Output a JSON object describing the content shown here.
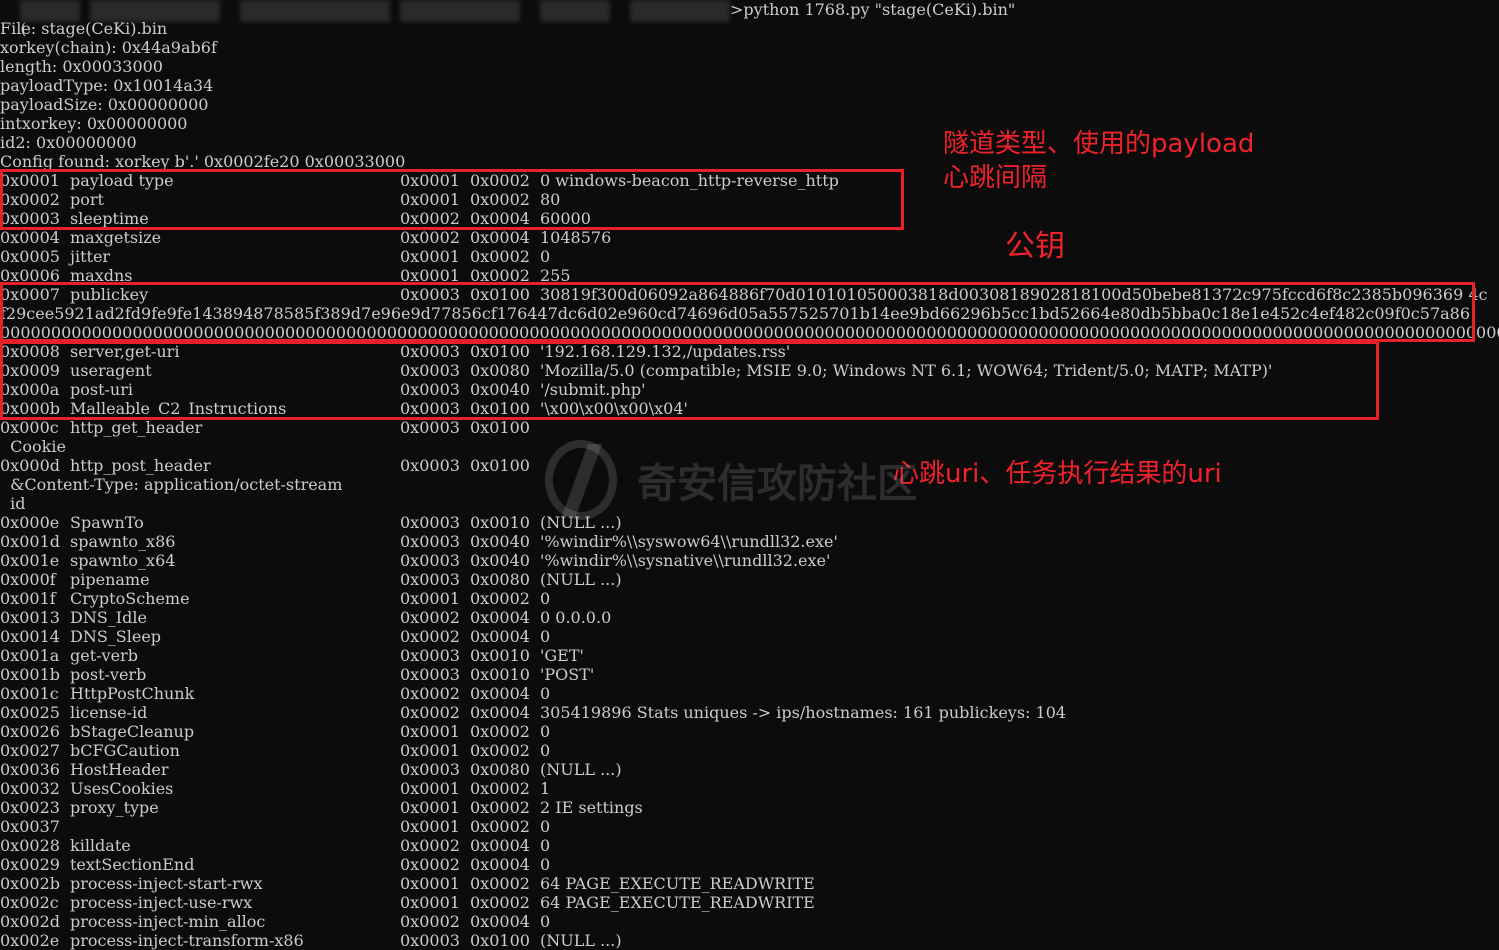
{
  "prompt": {
    "prefix": "(",
    "command": ">python 1768.py \"stage(CeKi).bin\""
  },
  "header_lines": [
    "File: stage(CeKi).bin",
    "xorkey(chain): 0x44a9ab6f",
    "length: 0x00033000",
    "payloadType: 0x10014a34",
    "payloadSize: 0x00000000",
    "intxorkey: 0x00000000",
    "id2: 0x00000000",
    "Config found: xorkey b'.' 0x0002fe20 0x00033000"
  ],
  "entries": [
    {
      "id": "0x0001",
      "name": "payload type",
      "type": "0x0001",
      "len": "0x0002",
      "value": "0 windows-beacon_http-reverse_http"
    },
    {
      "id": "0x0002",
      "name": "port",
      "type": "0x0001",
      "len": "0x0002",
      "value": "80"
    },
    {
      "id": "0x0003",
      "name": "sleeptime",
      "type": "0x0002",
      "len": "0x0004",
      "value": "60000"
    },
    {
      "id": "0x0004",
      "name": "maxgetsize",
      "type": "0x0002",
      "len": "0x0004",
      "value": "1048576"
    },
    {
      "id": "0x0005",
      "name": "jitter",
      "type": "0x0001",
      "len": "0x0002",
      "value": "0"
    },
    {
      "id": "0x0006",
      "name": "maxdns",
      "type": "0x0001",
      "len": "0x0002",
      "value": "255"
    },
    {
      "id": "0x0007",
      "name": "publickey",
      "type": "0x0003",
      "len": "0x0100",
      "value": "30819f300d06092a864886f70d010101050003818d0030818902818100d50bebe81372c975fccd6f8c2385b096369 4c"
    }
  ],
  "publickey_cont": [
    "f29cee5921ad2fd9fe9fe143894878585f389d7e96e9d77856cf176447dc6d02e960cd74696d05a557525701b14ee9bd66296b5cc1bd52664e80db5bba0c18e1e452c4ef482c09f0c57a86",
    "000000000000000000000000000000000000000000000000000000000000000000000000000000000000000000000000000000000000000000000000000000000000000000000000000000"
  ],
  "entries2": [
    {
      "id": "0x0008",
      "name": "server,get-uri",
      "type": "0x0003",
      "len": "0x0100",
      "value": "'192.168.129.132,/updates.rss'"
    },
    {
      "id": "0x0009",
      "name": "useragent",
      "type": "0x0003",
      "len": "0x0080",
      "value": "'Mozilla/5.0 (compatible; MSIE 9.0; Windows NT 6.1; WOW64; Trident/5.0; MATP; MATP)'"
    },
    {
      "id": "0x000a",
      "name": "post-uri",
      "type": "0x0003",
      "len": "0x0040",
      "value": "'/submit.php'"
    },
    {
      "id": "0x000b",
      "name": "Malleable_C2_Instructions",
      "type": "0x0003",
      "len": "0x0100",
      "value": "'\\x00\\x00\\x00\\x04'"
    },
    {
      "id": "0x000c",
      "name": "http_get_header",
      "type": "0x0003",
      "len": "0x0100",
      "value": ""
    }
  ],
  "sub_cookie": "  Cookie",
  "entry_post_header": {
    "id": "0x000d",
    "name": "http_post_header",
    "type": "0x0003",
    "len": "0x0100",
    "value": ""
  },
  "sub_content_type": "  &Content-Type: application/octet-stream",
  "sub_id": "  id",
  "entries3": [
    {
      "id": "0x000e",
      "name": "SpawnTo",
      "type": "0x0003",
      "len": "0x0010",
      "value": "(NULL ...)"
    },
    {
      "id": "0x001d",
      "name": "spawnto_x86",
      "type": "0x0003",
      "len": "0x0040",
      "value": "'%windir%\\\\syswow64\\\\rundll32.exe'"
    },
    {
      "id": "0x001e",
      "name": "spawnto_x64",
      "type": "0x0003",
      "len": "0x0040",
      "value": "'%windir%\\\\sysnative\\\\rundll32.exe'"
    },
    {
      "id": "0x000f",
      "name": "pipename",
      "type": "0x0003",
      "len": "0x0080",
      "value": "(NULL ...)"
    },
    {
      "id": "0x001f",
      "name": "CryptoScheme",
      "type": "0x0001",
      "len": "0x0002",
      "value": "0"
    },
    {
      "id": "0x0013",
      "name": "DNS_Idle",
      "type": "0x0002",
      "len": "0x0004",
      "value": "0 0.0.0.0"
    },
    {
      "id": "0x0014",
      "name": "DNS_Sleep",
      "type": "0x0002",
      "len": "0x0004",
      "value": "0"
    },
    {
      "id": "0x001a",
      "name": "get-verb",
      "type": "0x0003",
      "len": "0x0010",
      "value": "'GET'"
    },
    {
      "id": "0x001b",
      "name": "post-verb",
      "type": "0x0003",
      "len": "0x0010",
      "value": "'POST'"
    },
    {
      "id": "0x001c",
      "name": "HttpPostChunk",
      "type": "0x0002",
      "len": "0x0004",
      "value": "0"
    },
    {
      "id": "0x0025",
      "name": "license-id",
      "type": "0x0002",
      "len": "0x0004",
      "value": "305419896 Stats uniques -> ips/hostnames: 161 publickeys: 104"
    },
    {
      "id": "0x0026",
      "name": "bStageCleanup",
      "type": "0x0001",
      "len": "0x0002",
      "value": "0"
    },
    {
      "id": "0x0027",
      "name": "bCFGCaution",
      "type": "0x0001",
      "len": "0x0002",
      "value": "0"
    },
    {
      "id": "0x0036",
      "name": "HostHeader",
      "type": "0x0003",
      "len": "0x0080",
      "value": "(NULL ...)"
    },
    {
      "id": "0x0032",
      "name": "UsesCookies",
      "type": "0x0001",
      "len": "0x0002",
      "value": "1"
    },
    {
      "id": "0x0023",
      "name": "proxy_type",
      "type": "0x0001",
      "len": "0x0002",
      "value": "2 IE settings"
    },
    {
      "id": "0x0037",
      "name": "",
      "type": "0x0001",
      "len": "0x0002",
      "value": "0"
    },
    {
      "id": "0x0028",
      "name": "killdate",
      "type": "0x0002",
      "len": "0x0004",
      "value": "0"
    },
    {
      "id": "0x0029",
      "name": "textSectionEnd",
      "type": "0x0002",
      "len": "0x0004",
      "value": "0"
    },
    {
      "id": "0x002b",
      "name": "process-inject-start-rwx",
      "type": "0x0001",
      "len": "0x0002",
      "value": "64 PAGE_EXECUTE_READWRITE"
    },
    {
      "id": "0x002c",
      "name": "process-inject-use-rwx",
      "type": "0x0001",
      "len": "0x0002",
      "value": "64 PAGE_EXECUTE_READWRITE"
    },
    {
      "id": "0x002d",
      "name": "process-inject-min_alloc",
      "type": "0x0002",
      "len": "0x0004",
      "value": "0"
    },
    {
      "id": "0x002e",
      "name": "process-inject-transform-x86",
      "type": "0x0003",
      "len": "0x0100",
      "value": "(NULL ...)"
    }
  ],
  "annotations": {
    "tunnel_note": "隧道类型、使用的payload\n心跳间隔",
    "pubkey_note": "公钥",
    "uri_note": "心跳uri、任务执行结果的uri"
  },
  "watermark": "奇安信攻防社区",
  "colors": {
    "background": "#0c0c0c",
    "text": "#cccccc",
    "annotation_red": "#e8202a"
  }
}
